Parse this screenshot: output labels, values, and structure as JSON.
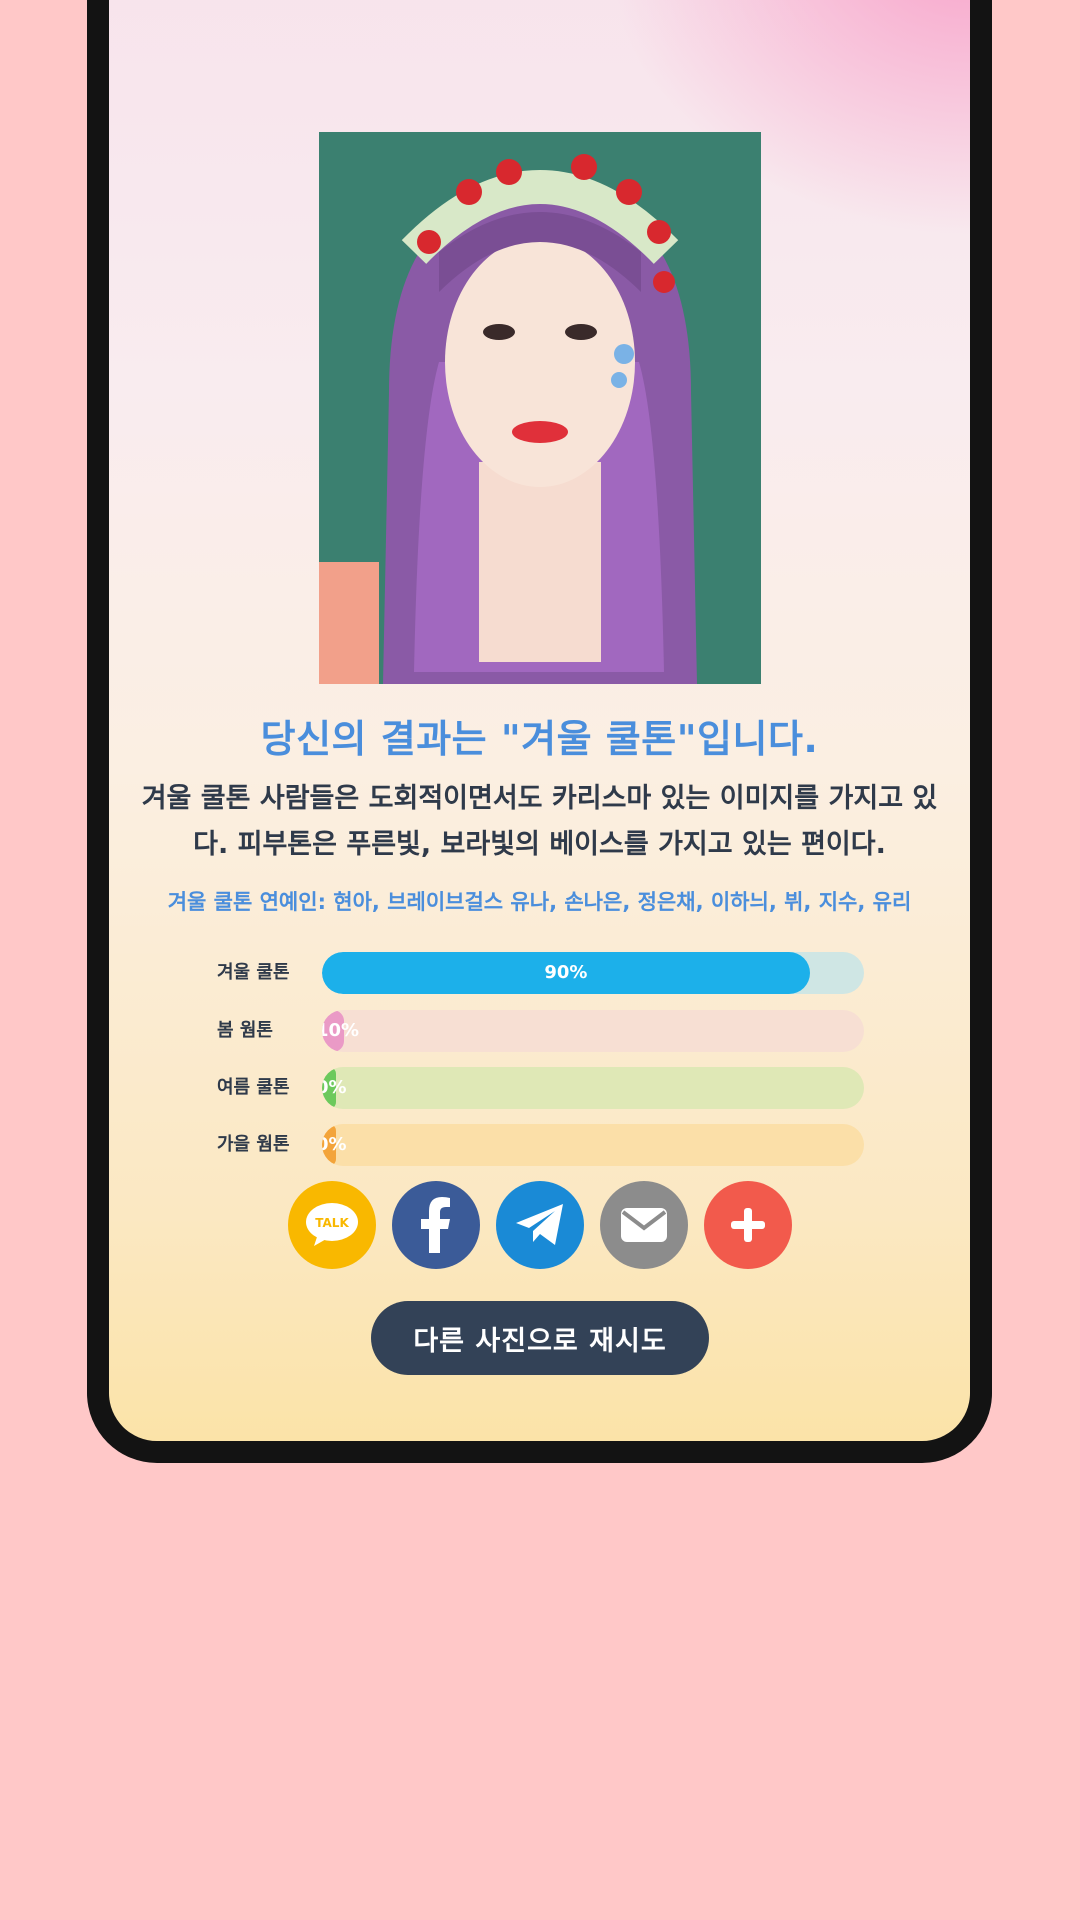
{
  "result": {
    "title": "당신의 결과는 \"겨울 쿨톤\"입니다.",
    "description": "겨울 쿨톤 사람들은 도회적이면서도 카리스마 있는 이미지를 가지고 있다. 피부톤은 푸른빛, 보라빛의 베이스를 가지고 있는 편이다.",
    "celebrities": "겨울 쿨톤 연예인: 현아, 브레이브걸스 유나, 손나은, 정은채, 이하늬, 뷔, 지수, 유리"
  },
  "bars": [
    {
      "label": "겨울 쿨톤",
      "percent_text": "90%",
      "value": 90,
      "fill_color": "#1cb0ea",
      "track_color": "#cfe6e4"
    },
    {
      "label": "봄 웜톤",
      "percent_text": "10%",
      "value": 4,
      "fill_color": "#ea9ac6",
      "track_color": "#f7dfd3"
    },
    {
      "label": "여름 쿨톤",
      "percent_text": "0%",
      "value": 0,
      "fill_color": "#6cc95c",
      "track_color": "#dfe8b6"
    },
    {
      "label": "가을 웜톤",
      "percent_text": "0%",
      "value": 0,
      "fill_color": "#f3a43a",
      "track_color": "#fbdfa8"
    }
  ],
  "share": [
    {
      "name": "kakao-talk",
      "label": "TALK",
      "color": "#f9b800"
    },
    {
      "name": "facebook",
      "label": "f",
      "color": "#3b5b98"
    },
    {
      "name": "telegram",
      "label": "",
      "color": "#1a8ad6"
    },
    {
      "name": "email",
      "label": "",
      "color": "#8c8c8c"
    },
    {
      "name": "more",
      "label": "+",
      "color": "#f25a4c"
    }
  ],
  "retry_label": "다른 사진으로 재시도"
}
